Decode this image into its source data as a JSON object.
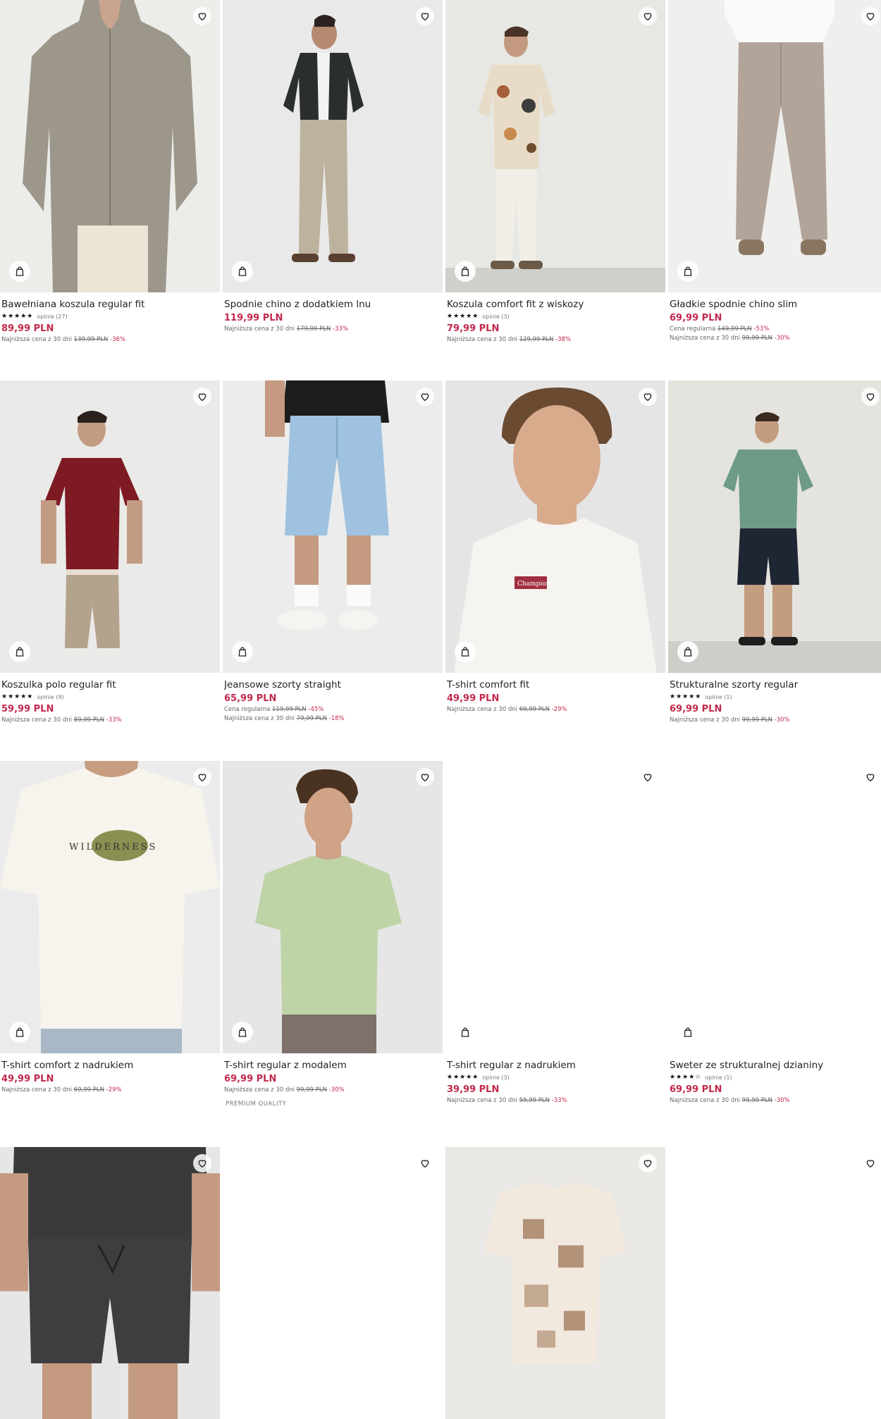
{
  "products": [
    {
      "name": "Bawełniana koszula regular fit",
      "stars": "★★★★★",
      "reviews": "opinie (27)",
      "price": "89,99 PLN",
      "lowest_label": "Najniższa cena z 30 dni",
      "lowest_old": "139,99 PLN",
      "lowest_disc": "-36%"
    },
    {
      "name": "Spodnie chino z dodatkiem lnu",
      "price": "119,99 PLN",
      "lowest_label": "Najniższa cena z 30 dni",
      "lowest_old": "179,99 PLN",
      "lowest_disc": "-33%"
    },
    {
      "name": "Koszula comfort fit z wiskozy",
      "stars": "★★★★★",
      "reviews": "opinie (3)",
      "price": "79,99 PLN",
      "lowest_label": "Najniższa cena z 30 dni",
      "lowest_old": "129,99 PLN",
      "lowest_disc": "-38%"
    },
    {
      "name": "Gładkie spodnie chino slim",
      "price": "69,99 PLN",
      "regular_label": "Cena regularna",
      "regular_old": "149,99 PLN",
      "regular_disc": "-53%",
      "lowest_label": "Najniższa cena z 30 dni",
      "lowest_old": "99,99 PLN",
      "lowest_disc": "-30%"
    },
    {
      "name": "Koszulka polo regular fit",
      "stars": "★★★★★",
      "reviews": "opinie (9)",
      "price": "59,99 PLN",
      "lowest_label": "Najniższa cena z 30 dni",
      "lowest_old": "89,99 PLN",
      "lowest_disc": "-33%"
    },
    {
      "name": "Jeansowe szorty straight",
      "price": "65,99 PLN",
      "regular_label": "Cena regularna",
      "regular_old": "119,99 PLN",
      "regular_disc": "-45%",
      "lowest_label": "Najniższa cena z 30 dni",
      "lowest_old": "79,99 PLN",
      "lowest_disc": "-18%"
    },
    {
      "name": "T-shirt comfort fit",
      "price": "49,99 PLN",
      "lowest_label": "Najniższa cena z 30 dni",
      "lowest_old": "69,99 PLN",
      "lowest_disc": "-29%"
    },
    {
      "name": "Strukturalne szorty regular",
      "stars": "★★★★★",
      "reviews": "opinie (1)",
      "price": "69,99 PLN",
      "lowest_label": "Najniższa cena z 30 dni",
      "lowest_old": "99,99 PLN",
      "lowest_disc": "-30%"
    },
    {
      "name": "T-shirt comfort z nadrukiem",
      "price": "49,99 PLN",
      "lowest_label": "Najniższa cena z 30 dni",
      "lowest_old": "69,99 PLN",
      "lowest_disc": "-29%",
      "print_text": "WILDERNESS"
    },
    {
      "name": "T-shirt regular z modalem",
      "price": "69,99 PLN",
      "lowest_label": "Najniższa cena z 30 dni",
      "lowest_old": "99,99 PLN",
      "lowest_disc": "-30%",
      "badge": "PREMIUM QUALITY"
    },
    {
      "name": "T-shirt regular z nadrukiem",
      "stars": "★★★★★",
      "reviews": "opinie (3)",
      "price": "39,99 PLN",
      "lowest_label": "Najniższa cena z 30 dni",
      "lowest_old": "59,99 PLN",
      "lowest_disc": "-33%"
    },
    {
      "name": "Sweter ze strukturalnej dzianiny",
      "stars": "★★★★☆",
      "reviews": "opinie (1)",
      "price": "69,99 PLN",
      "lowest_label": "Najniższa cena z 30 dni",
      "lowest_old": "99,99 PLN",
      "lowest_disc": "-30%"
    }
  ],
  "icons": {
    "favorite": "heart-outline-icon",
    "add_to_cart": "shopping-bag-icon"
  },
  "colors": {
    "price": "#c2294c",
    "discount": "#c2294c",
    "text": "#222222"
  },
  "tshirt_logo_text": "Champions"
}
